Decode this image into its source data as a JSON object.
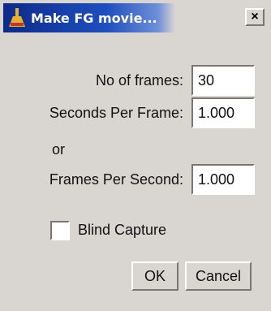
{
  "window": {
    "title": "Make FG movie...",
    "close_label": "×",
    "icon": "app-flask-icon"
  },
  "form": {
    "frames_label": "No of frames:",
    "frames_value": "30",
    "seconds_per_frame_label": "Seconds Per Frame:",
    "seconds_per_frame_value": "1.000",
    "or_label": "or",
    "frames_per_second_label": "Frames Per Second:",
    "frames_per_second_value": "1.000",
    "blind_capture_label": "Blind Capture",
    "blind_capture_checked": false
  },
  "buttons": {
    "ok_label": "OK",
    "cancel_label": "Cancel"
  },
  "colors": {
    "title_bar": "#0c2a8a",
    "dialog_bg": "#d9d6d1"
  }
}
